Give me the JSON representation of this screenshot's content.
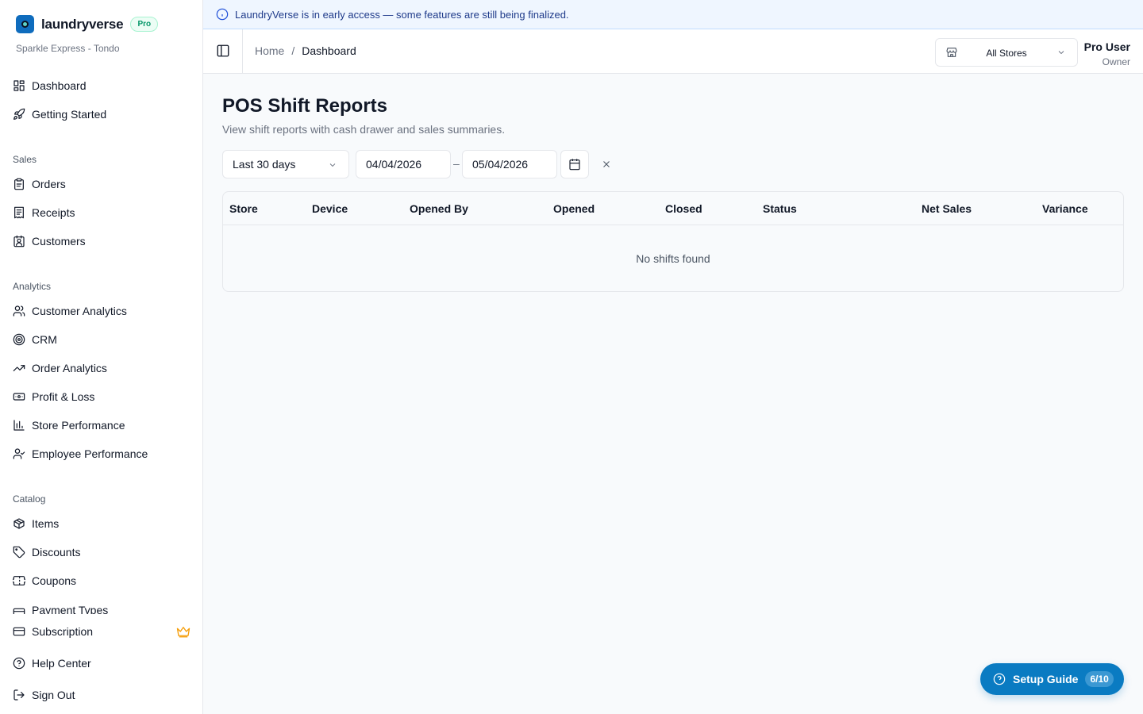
{
  "brand": {
    "name": "laundryverse",
    "badge": "Pro",
    "store_subtitle": "Sparkle Express - Tondo"
  },
  "sidebar": {
    "top_items": [
      {
        "label": "Dashboard",
        "icon": "dashboard-icon"
      },
      {
        "label": "Getting Started",
        "icon": "rocket-icon"
      }
    ],
    "sections": [
      {
        "label": "Sales",
        "items": [
          {
            "label": "Orders",
            "icon": "clipboard-icon"
          },
          {
            "label": "Receipts",
            "icon": "receipt-icon"
          },
          {
            "label": "Customers",
            "icon": "contact-icon"
          }
        ]
      },
      {
        "label": "Analytics",
        "items": [
          {
            "label": "Customer Analytics",
            "icon": "users-icon"
          },
          {
            "label": "CRM",
            "icon": "target-icon"
          },
          {
            "label": "Order Analytics",
            "icon": "trending-up-icon"
          },
          {
            "label": "Profit & Loss",
            "icon": "banknote-icon"
          },
          {
            "label": "Store Performance",
            "icon": "bar-chart-icon"
          },
          {
            "label": "Employee Performance",
            "icon": "user-check-icon"
          }
        ]
      },
      {
        "label": "Catalog",
        "items": [
          {
            "label": "Items",
            "icon": "package-icon"
          },
          {
            "label": "Discounts",
            "icon": "tag-icon"
          },
          {
            "label": "Coupons",
            "icon": "ticket-icon"
          },
          {
            "label": "Payment Types",
            "icon": "wallet-icon"
          }
        ]
      }
    ],
    "bottom_items": [
      {
        "label": "Subscription",
        "icon": "credit-card-icon"
      },
      {
        "label": "Help Center",
        "icon": "help-circle-icon"
      },
      {
        "label": "Sign Out",
        "icon": "log-out-icon"
      }
    ],
    "subscription_badge_icon": "crown-icon",
    "subscription_badge_color": "#f59e0b"
  },
  "banner": {
    "text": "LaundryVerse is in early access — some features are still being finalized."
  },
  "header": {
    "breadcrumb": {
      "home": "Home",
      "separator": "/",
      "current": "Dashboard"
    },
    "store_select": {
      "value": "All Stores"
    },
    "user": {
      "name": "Pro User",
      "role": "Owner"
    }
  },
  "main": {
    "title": "POS Shift Reports",
    "subtitle": "View shift reports with cash drawer and sales summaries.",
    "filters": {
      "range": "Last 30 days",
      "start_date": "04/04/2026",
      "end_date": "05/04/2026",
      "range_separator": "–"
    },
    "table": {
      "columns": [
        "Store",
        "Device",
        "Opened By",
        "Opened",
        "Closed",
        "Status",
        "Net Sales",
        "Variance"
      ],
      "rows": [],
      "empty_text": "No shifts found"
    }
  },
  "setup_guide": {
    "label": "Setup Guide",
    "progress": "6/10"
  },
  "colors": {
    "accent": "#0a7bc2",
    "banner_bg": "#eff6ff",
    "pro_badge": "#059669"
  }
}
